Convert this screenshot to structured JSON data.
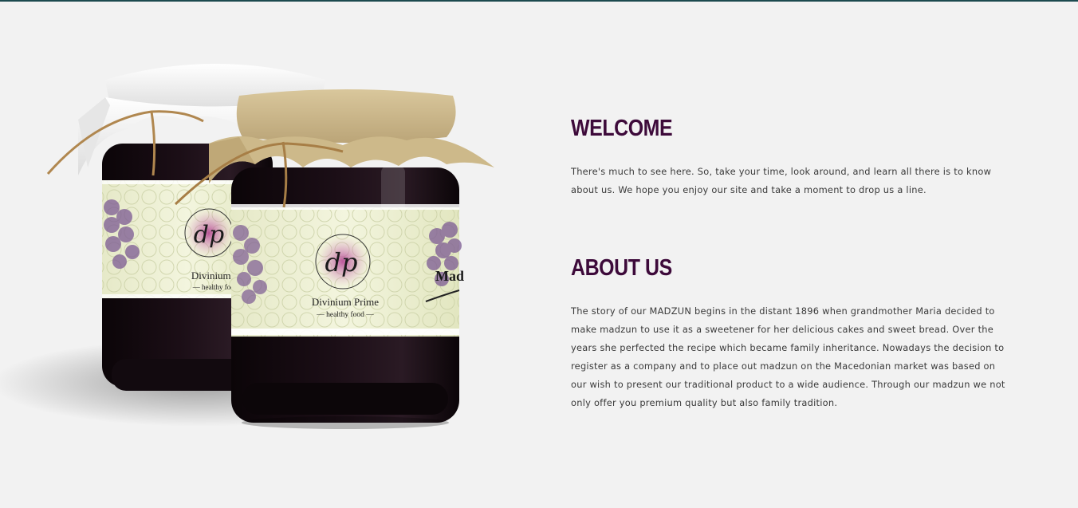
{
  "colors": {
    "heading": "#3d0a3a",
    "body_text": "#3a3a3a",
    "page_background": "#f2f2f2",
    "top_border": "#1c4a4f"
  },
  "hero": {
    "image": "product-jars-image",
    "jar_label": {
      "monogram": "dp",
      "brand": "Divinium Prime",
      "tagline": "healthy food",
      "side_text": "Mad"
    }
  },
  "welcome": {
    "title": "WELCOME",
    "text": "There's much to see here. So, take your time, look around, and learn all there is to know about us. We hope you enjoy our site and take a moment to drop us a line."
  },
  "about": {
    "title": "ABOUT US",
    "text": "The story of our MADZUN begins in the distant 1896 when grandmother Maria decided to make madzun to use it as a sweetener for her delicious cakes and sweet bread. Over the years she perfected the recipe which became family inheritance. Nowadays the decision to register as a company and to place out madzun on the Macedonian market was based on our wish to present our traditional product to a wide audience. Through our madzun we not only offer you premium quality but also family tradition."
  }
}
